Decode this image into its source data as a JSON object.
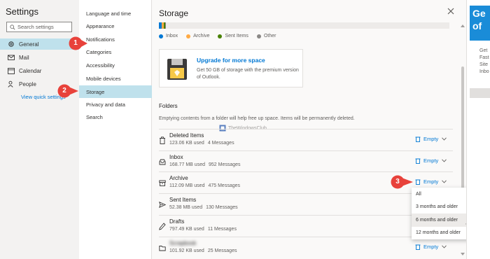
{
  "left_nav": {
    "title": "Settings",
    "search_placeholder": "Search settings",
    "items": [
      {
        "label": "General",
        "icon": "gear-icon",
        "selected": true
      },
      {
        "label": "Mail",
        "icon": "mail-icon",
        "selected": false
      },
      {
        "label": "Calendar",
        "icon": "calendar-icon",
        "selected": false
      },
      {
        "label": "People",
        "icon": "people-icon",
        "selected": false
      }
    ],
    "quick_settings_link": "View quick settings"
  },
  "sub_nav": {
    "items": [
      {
        "label": "Language and time",
        "selected": false
      },
      {
        "label": "Appearance",
        "selected": false
      },
      {
        "label": "Notifications",
        "selected": false
      },
      {
        "label": "Categories",
        "selected": false
      },
      {
        "label": "Accessibility",
        "selected": false
      },
      {
        "label": "Mobile devices",
        "selected": false
      },
      {
        "label": "Storage",
        "selected": true
      },
      {
        "label": "Privacy and data",
        "selected": false
      },
      {
        "label": "Search",
        "selected": false
      }
    ]
  },
  "storage": {
    "title": "Storage",
    "legend": [
      {
        "label": "Inbox",
        "color": "#0078d4"
      },
      {
        "label": "Archive",
        "color": "#ffaa44"
      },
      {
        "label": "Sent Items",
        "color": "#498205"
      },
      {
        "label": "Other",
        "color": "#8a8886"
      }
    ],
    "upgrade": {
      "title": "Upgrade for more space",
      "description": "Get 50 GB of storage with the premium version of Outlook."
    },
    "folders_heading": "Folders",
    "folders_description": "Emptying contents from a folder will help free up space. Items will be permanently deleted.",
    "watermark": "TheWindowsClub",
    "empty_label": "Empty",
    "folders": [
      {
        "name": "Deleted Items",
        "size": "123.06 KB used",
        "count": "4 Messages",
        "icon": "trash-icon"
      },
      {
        "name": "Inbox",
        "size": "168.77 MB used",
        "count": "952 Messages",
        "icon": "inbox-icon"
      },
      {
        "name": "Archive",
        "size": "112.09 MB used",
        "count": "475 Messages",
        "icon": "archive-icon"
      },
      {
        "name": "Sent Items",
        "size": "52.38 MB used",
        "count": "130 Messages",
        "icon": "send-icon"
      },
      {
        "name": "Drafts",
        "size": "797.49 KB used",
        "count": "11 Messages",
        "icon": "pencil-icon"
      },
      {
        "name": "Scrapbook",
        "size": "101.92 KB used",
        "count": "25 Messages",
        "icon": "folder-icon"
      }
    ],
    "dropdown_options": [
      "All",
      "3 months and older",
      "6 months and older",
      "12 months and older"
    ],
    "dropdown_hovered": "6 months and older"
  },
  "callouts": [
    "1",
    "2",
    "3"
  ],
  "ad": {
    "headline_line1": "Ge",
    "headline_line2": "of",
    "text_lines": [
      "Get",
      "Fast",
      "Site",
      "Inbo"
    ]
  }
}
